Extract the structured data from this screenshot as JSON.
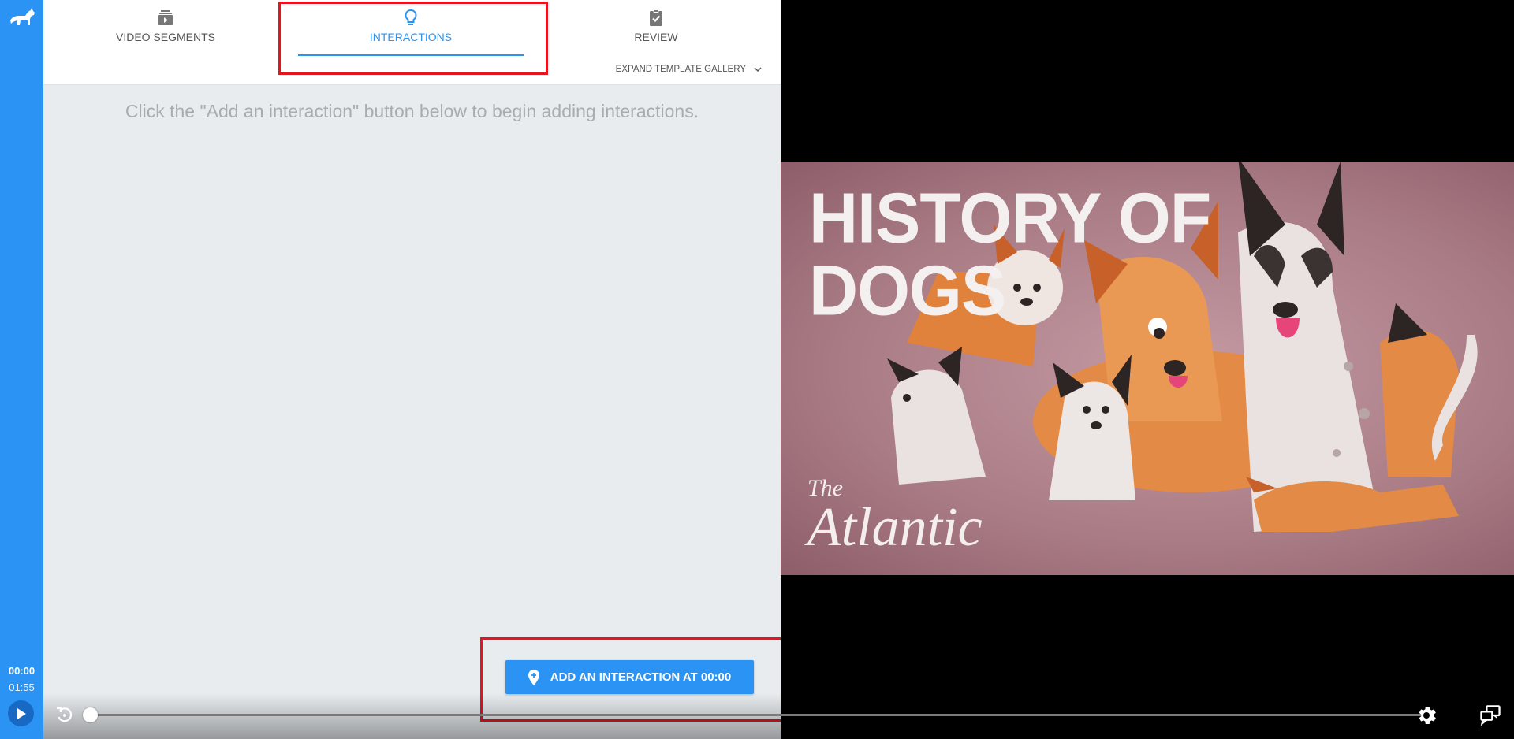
{
  "tabs": [
    {
      "label": "VIDEO SEGMENTS",
      "icon": "layers-video-icon",
      "active": false
    },
    {
      "label": "INTERACTIONS",
      "icon": "lightbulb-icon",
      "active": true
    },
    {
      "label": "REVIEW",
      "icon": "clipboard-check-icon",
      "active": false
    }
  ],
  "expand_gallery_label": "EXPAND TEMPLATE GALLERY",
  "hint": "Click the \"Add an interaction\" button below to begin adding interactions.",
  "add_button_label": "ADD AN INTERACTION AT 00:00",
  "time": {
    "current": "00:00",
    "total": "01:55"
  },
  "progress": 0,
  "video": {
    "title_line1": "HISTORY OF",
    "title_line2": "DOGS",
    "brand_the": "The",
    "brand_name": "Atlantic"
  },
  "colors": {
    "accent": "#2a93f3",
    "highlight": "#e5141f"
  }
}
